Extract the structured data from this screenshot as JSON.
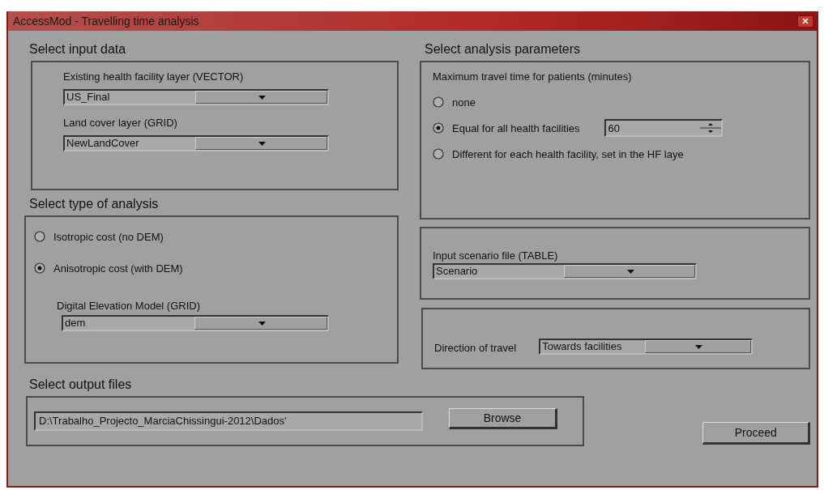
{
  "window": {
    "title": "AccessMod - Travelling time analysis"
  },
  "input_data": {
    "heading": "Select input data",
    "fields": [
      {
        "label": "Existing health facility layer (VECTOR)",
        "value": "US_Final"
      },
      {
        "label": "Land cover layer (GRID)",
        "value": "NewLandCover"
      }
    ]
  },
  "analysis_type": {
    "heading": "Select type of analysis",
    "options": [
      {
        "label": "Isotropic cost (no DEM)",
        "selected": false
      },
      {
        "label": "Anisotropic cost (with DEM)",
        "selected": true
      }
    ],
    "dem": {
      "label": "Digital Elevation Model (GRID)",
      "value": "dem"
    }
  },
  "parameters": {
    "heading": "Select analysis parameters",
    "max_time_label": "Maximum travel time for patients (minutes)",
    "options": [
      {
        "label": "none",
        "selected": false
      },
      {
        "label": "Equal for all health facilities",
        "selected": true,
        "spin_value": "60"
      },
      {
        "label": "Different for each health facility, set in the HF laye",
        "selected": false
      }
    ],
    "scenario": {
      "label": "Input scenario file (TABLE)",
      "value": "Scenario"
    },
    "direction": {
      "label": "Direction of travel",
      "value": "Towards facilities"
    }
  },
  "output": {
    "heading": "Select output files",
    "path": "D:\\Trabalho_Projecto_MarciaChissingui-2012\\Dados'",
    "browse": "Browse"
  },
  "proceed": "Proceed"
}
